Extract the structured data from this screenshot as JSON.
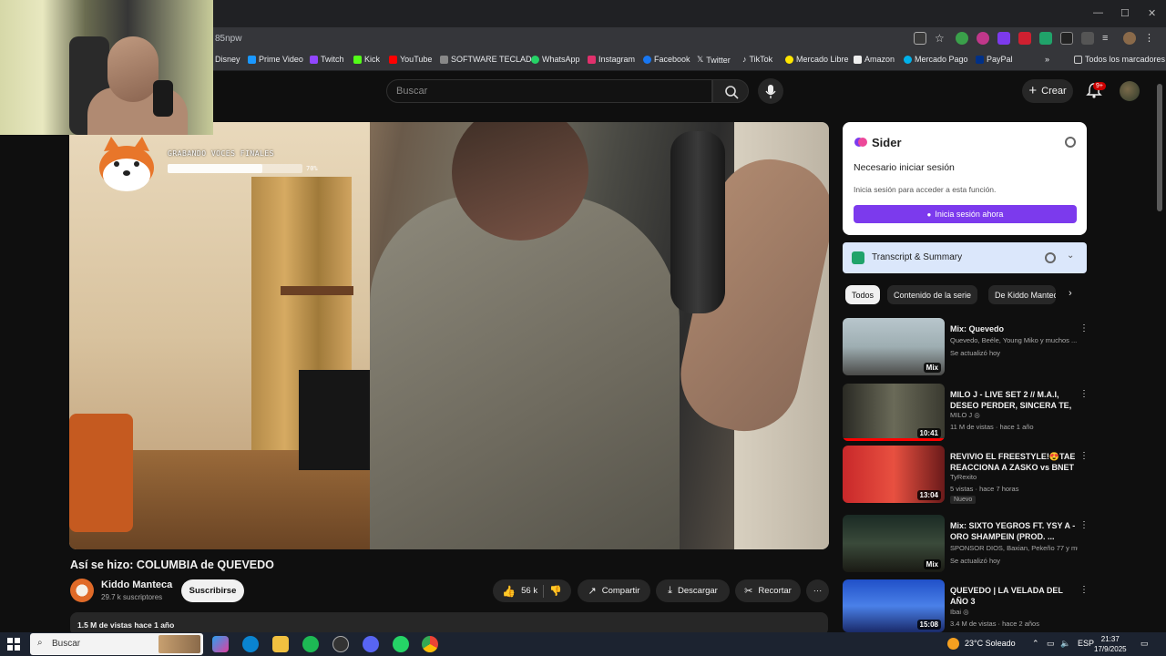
{
  "browser": {
    "url": "85npw",
    "bookmarks": [
      "Disney",
      "Prime Video",
      "Twitch",
      "Kick",
      "YouTube",
      "SOFTWARE TECLADO",
      "WhatsApp",
      "Instagram",
      "Facebook",
      "Twitter",
      "TikTok",
      "Mercado Libre",
      "Amazon",
      "Mercado Pago",
      "PayPal"
    ],
    "all_bookmarks": "Todos los marcadores"
  },
  "header": {
    "search_placeholder": "Buscar",
    "create_label": "Crear",
    "notif_count": "9+"
  },
  "video": {
    "overlay_text": "GRABANDO VOCES FINALES",
    "overlay_progress": 0.7,
    "overlay_percent": "70%",
    "title": "Así se hizo: COLUMBIA de QUEVEDO",
    "channel": "Kiddo Manteca",
    "subscribers": "29.7 k suscriptores",
    "subscribe": "Suscribirse",
    "likes": "56 k",
    "share": "Compartir",
    "download": "Descargar",
    "clip": "Recortar",
    "more": "···",
    "description": "1.5 M de vistas  hace 1 año"
  },
  "sider": {
    "brand": "Sider",
    "need_login": "Necesario iniciar sesión",
    "sub": "Inicia sesión para acceder a esta función.",
    "button": "Inicia sesión ahora",
    "transcript": "Transcript & Summary"
  },
  "chips": [
    "Todos",
    "Contenido de la serie",
    "De Kiddo Manteca"
  ],
  "recs": [
    {
      "title": "Mix: Quevedo",
      "meta1": "Quevedo, Beéle, Young Miko y muchos ...",
      "meta2": "Se actualizó hoy",
      "badge": "Mix"
    },
    {
      "title": "MILO J - LIVE SET 2 // M.A.I, DESEO PERDER, SINCERA TE, ...",
      "meta1": "MILO J ◎",
      "meta2": "11 M de vistas · hace 1 año",
      "badge": "10:41"
    },
    {
      "title": "REVIVIO EL FREESTYLE!😍TAE REACCIONA A ZASKO vs BNET ...",
      "meta1": "TyRexito",
      "meta2": "5 vistas · hace 7 horas",
      "badge": "13:04",
      "tag": "Nuevo"
    },
    {
      "title": "Mix: SIXTO YEGROS FT. YSY A - ORO SHAMPEIN (PROD. ...",
      "meta1": "SPONSOR DIOS, Baxian, Pekeño 77 y mu...",
      "meta2": "Se actualizó hoy",
      "badge": "Mix"
    },
    {
      "title": "QUEVEDO | LA VELADA DEL AÑO 3",
      "meta1": "Ibai ◎",
      "meta2": "3.4 M de vistas · hace 2 años",
      "badge": "15:08"
    }
  ],
  "taskbar": {
    "search": "Buscar",
    "weather": "23°C  Soleado",
    "lang": "ESP",
    "time": "21:37",
    "date": "17/9/2025"
  }
}
